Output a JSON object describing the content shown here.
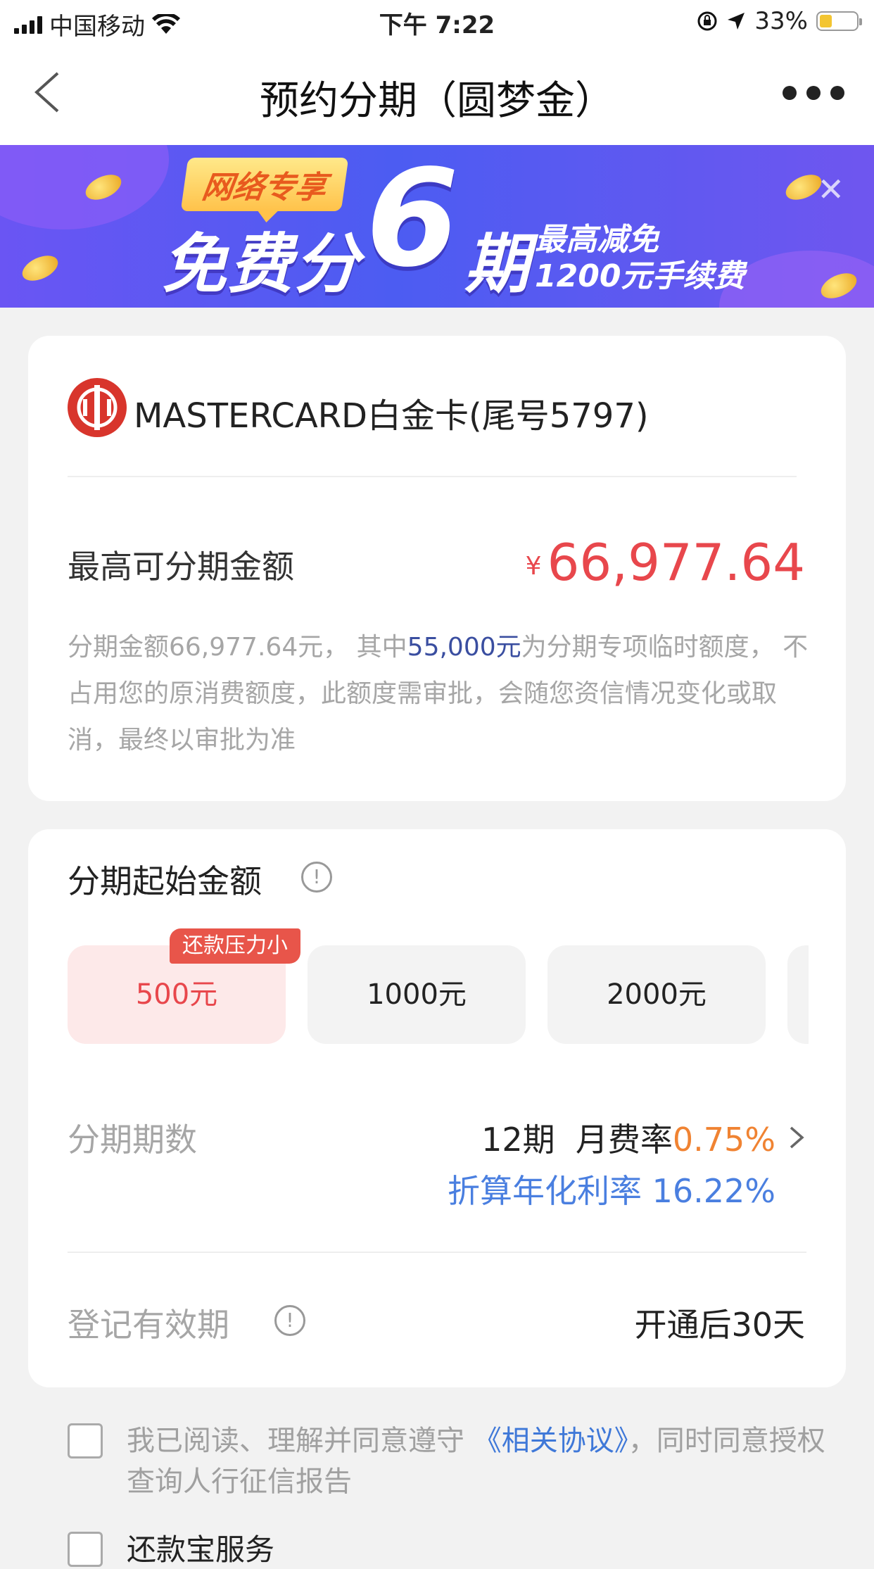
{
  "status_bar": {
    "carrier": "中国移动",
    "time": "下午 7:22",
    "battery": "33%",
    "battery_level": 0.33
  },
  "nav": {
    "title": "预约分期（圆梦金）"
  },
  "banner": {
    "tag": "网络专享",
    "headline_a": "免费分",
    "headline_num": "6",
    "headline_b": "期",
    "sub_line1": "最高减免",
    "sub_line2": "1200元手续费"
  },
  "card": {
    "name": "MASTERCARD白金卡(尾号5797)",
    "max_label": "最高可分期金额",
    "currency": "¥",
    "max_amount": "66,977.64",
    "desc_pre": "分期金额66,977.64元， 其中",
    "desc_highlight": "55,000元",
    "desc_post": "为分期专项临时额度， 不占用您的原消费额度，此额度需审批，会随您资信情况变化或取消，最终以审批为准"
  },
  "installment": {
    "start_label": "分期起始金额",
    "tag": "还款压力小",
    "options": [
      "500元",
      "1000元",
      "2000元"
    ],
    "selected_index": 0,
    "period_label": "分期期数",
    "period_value": "12期",
    "fee_label": "月费率",
    "fee_rate": "0.75%",
    "apr_text": "折算年化利率 16.22%",
    "valid_label": "登记有效期",
    "valid_value": "开通后30天"
  },
  "agreement": {
    "text_pre": "我已阅读、理解并同意遵守",
    "link": "《相关协议》",
    "text_post": "，同时同意授权查询人行征信报告",
    "service_label": "还款宝服务"
  },
  "colors": {
    "accent_red": "#e8474c",
    "accent_orange": "#f08332",
    "link_blue": "#3f78d8",
    "banner_purple": "#5a5af0"
  },
  "icons": [
    "signal-icon",
    "wifi-icon",
    "orientation-lock-icon",
    "location-arrow-icon",
    "battery-icon",
    "back-arrow-icon",
    "more-icon",
    "close-icon",
    "bank-logo-icon",
    "info-icon",
    "chevron-right-icon"
  ]
}
